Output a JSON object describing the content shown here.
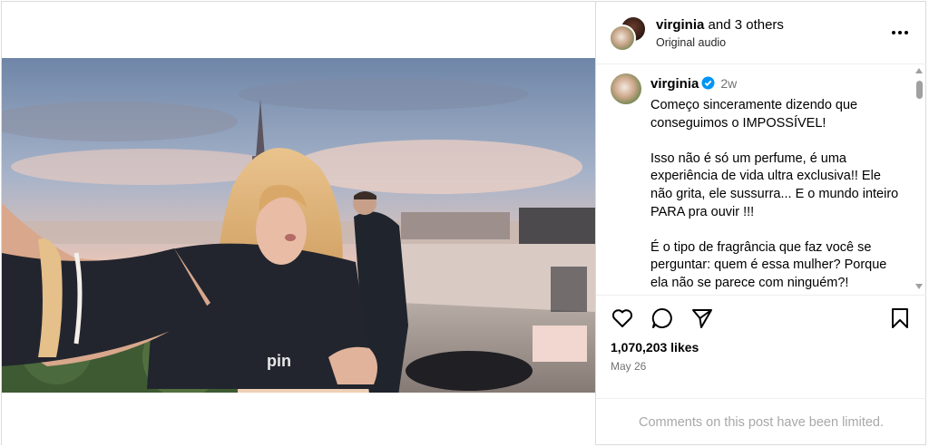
{
  "post": {
    "header": {
      "username": "virginia",
      "collab_suffix": " and 3 others",
      "audio": "Original audio"
    },
    "caption": {
      "username": "virginia",
      "time": "2w",
      "paragraphs": [
        "Começo sinceramente dizendo que conseguimos o IMPOSSÍVEL!",
        "Isso não é só um perfume, é uma experiência de vida ultra exclusiva!! Ele não grita, ele sussurra... E o mundo inteiro PARA pra ouvir !!!",
        "É o tipo de fragrância que faz você se perguntar: quem é essa mulher? Porque ela não se parece com ninguém?!"
      ]
    },
    "likes": "1,070,203 likes",
    "date": "May 26",
    "comments_notice": "Comments on this post have been limited."
  },
  "icons": {
    "more": "more-options-icon",
    "verified": "verified-badge-icon",
    "like": "heart-icon",
    "comment": "comment-icon",
    "share": "share-icon",
    "save": "bookmark-icon",
    "tag": "user-tag-icon",
    "mute": "muted-speaker-icon"
  },
  "colors": {
    "verified": "#0095f6",
    "secondary_text": "#737373",
    "muted_text": "#a8a8a8",
    "border": "#dbdbdb"
  }
}
